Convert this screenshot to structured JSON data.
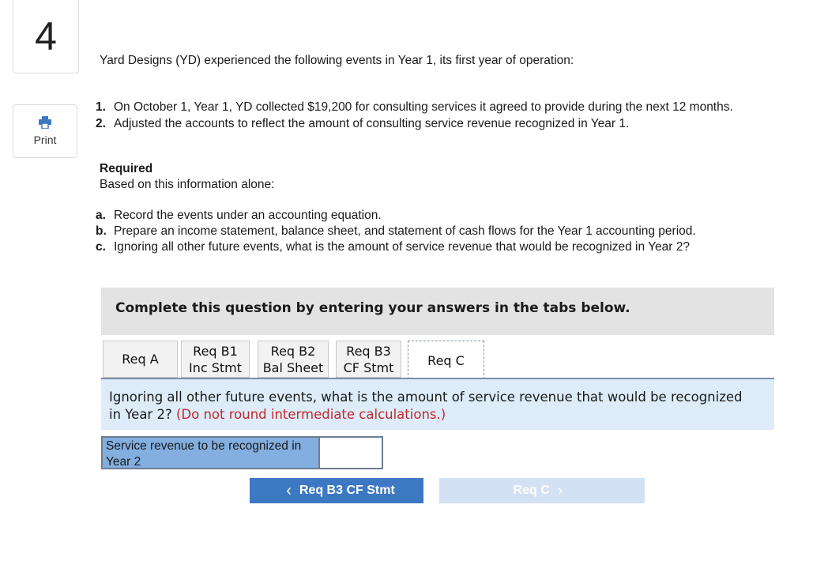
{
  "question": {
    "number": "4",
    "print_label": "Print",
    "intro": "Yard Designs (YD) experienced the following events in Year 1, its first year of operation:",
    "events": [
      {
        "num": "1.",
        "text": "On October 1, Year 1, YD collected $19,200 for consulting services it agreed to provide during the next 12 months."
      },
      {
        "num": "2.",
        "text": "Adjusted the accounts to reflect the amount of consulting service revenue recognized in Year 1."
      }
    ],
    "required_title": "Required",
    "required_sub": "Based on this information alone:",
    "requirements": [
      {
        "letter": "a.",
        "text": "Record the events under an accounting equation."
      },
      {
        "letter": "b.",
        "text": "Prepare an income statement, balance sheet, and statement of cash flows for the Year 1 accounting period."
      },
      {
        "letter": "c.",
        "text": "Ignoring all other future events, what is the amount of service revenue that would be recognized in Year 2?"
      }
    ]
  },
  "banner": "Complete this question by entering your answers in the tabs below.",
  "tabs": [
    {
      "line1": "Req A",
      "line2": ""
    },
    {
      "line1": "Req B1",
      "line2": "Inc Stmt"
    },
    {
      "line1": "Req B2",
      "line2": "Bal Sheet"
    },
    {
      "line1": "Req B3",
      "line2": "CF Stmt"
    },
    {
      "line1": "Req C",
      "line2": ""
    }
  ],
  "active_tab": "Req C",
  "panel": {
    "question": "Ignoring all other future events, what is the amount of service revenue that would be recognized in Year 2?",
    "note": "(Do not round intermediate calculations.)"
  },
  "answer": {
    "label": "Service revenue to be recognized in Year 2",
    "value": ""
  },
  "nav": {
    "prev_label": "Req B3 CF Stmt",
    "next_label": "Req C"
  },
  "colors": {
    "nav_prev_bg": "#3d78c2",
    "nav_next_bg": "#d2e1f3",
    "answer_label_bg": "#83aee0",
    "note": "#c0282d"
  },
  "icons": [
    "printer-icon",
    "chevron-left-icon",
    "chevron-right-icon"
  ]
}
